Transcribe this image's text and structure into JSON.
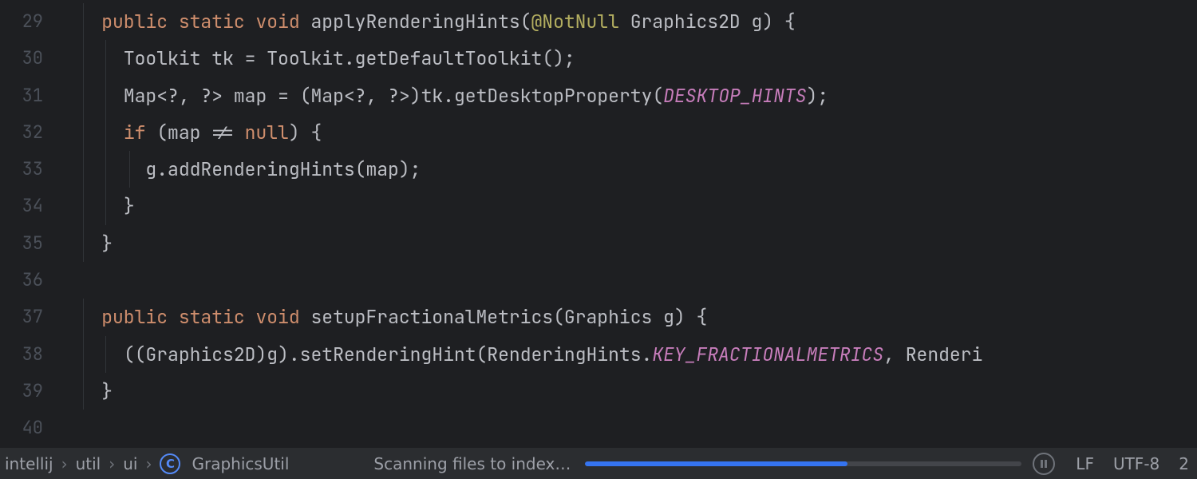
{
  "gutter": {
    "start": 29,
    "end": 40
  },
  "code": {
    "lines": [
      {
        "indents": [
          2
        ],
        "tokens": [
          {
            "cls": "kw",
            "t": "public"
          },
          {
            "cls": "pn",
            "t": " "
          },
          {
            "cls": "kw",
            "t": "static"
          },
          {
            "cls": "pn",
            "t": " "
          },
          {
            "cls": "kw",
            "t": "void"
          },
          {
            "cls": "pn",
            "t": " "
          },
          {
            "cls": "fn",
            "t": "applyRenderingHints"
          },
          {
            "cls": "pn",
            "t": "("
          },
          {
            "cls": "ann",
            "t": "@NotNull"
          },
          {
            "cls": "pn",
            "t": " "
          },
          {
            "cls": "id",
            "t": "Graphics2D g"
          },
          {
            "cls": "pn",
            "t": ") {"
          }
        ]
      },
      {
        "indents": [
          2,
          3
        ],
        "tokens": [
          {
            "cls": "id",
            "t": "Toolkit tk "
          },
          {
            "cls": "op",
            "t": "= "
          },
          {
            "cls": "id",
            "t": "Toolkit"
          },
          {
            "cls": "pn",
            "t": "."
          },
          {
            "cls": "id",
            "t": "getDefaultToolkit"
          },
          {
            "cls": "pn",
            "t": "();"
          }
        ]
      },
      {
        "indents": [
          2,
          3
        ],
        "tokens": [
          {
            "cls": "id",
            "t": "Map"
          },
          {
            "cls": "pn",
            "t": "<"
          },
          {
            "cls": "id",
            "t": "?"
          },
          {
            "cls": "pn",
            "t": ", "
          },
          {
            "cls": "id",
            "t": "?"
          },
          {
            "cls": "pn",
            "t": "> "
          },
          {
            "cls": "id",
            "t": "map "
          },
          {
            "cls": "op",
            "t": "= "
          },
          {
            "cls": "pn",
            "t": "("
          },
          {
            "cls": "id",
            "t": "Map"
          },
          {
            "cls": "pn",
            "t": "<"
          },
          {
            "cls": "id",
            "t": "?"
          },
          {
            "cls": "pn",
            "t": ", "
          },
          {
            "cls": "id",
            "t": "?"
          },
          {
            "cls": "pn",
            "t": ">)"
          },
          {
            "cls": "id",
            "t": "tk"
          },
          {
            "cls": "pn",
            "t": "."
          },
          {
            "cls": "id",
            "t": "getDesktopProperty"
          },
          {
            "cls": "pn",
            "t": "("
          },
          {
            "cls": "cst",
            "t": "DESKTOP_HINTS"
          },
          {
            "cls": "pn",
            "t": ");"
          }
        ]
      },
      {
        "indents": [
          2,
          3
        ],
        "tokens": [
          {
            "cls": "kw",
            "t": "if"
          },
          {
            "cls": "pn",
            "t": " ("
          },
          {
            "cls": "id",
            "t": "map "
          },
          {
            "cls": "op",
            "t": "!= "
          },
          {
            "cls": "kw",
            "t": "null"
          },
          {
            "cls": "pn",
            "t": ") {"
          }
        ]
      },
      {
        "indents": [
          2,
          3,
          4
        ],
        "tokens": [
          {
            "cls": "id",
            "t": "g"
          },
          {
            "cls": "pn",
            "t": "."
          },
          {
            "cls": "id",
            "t": "addRenderingHints"
          },
          {
            "cls": "pn",
            "t": "("
          },
          {
            "cls": "id",
            "t": "map"
          },
          {
            "cls": "pn",
            "t": ");"
          }
        ]
      },
      {
        "indents": [
          2,
          3
        ],
        "tokens": [
          {
            "cls": "pn",
            "t": "}"
          }
        ]
      },
      {
        "indents": [
          2
        ],
        "tokens": [
          {
            "cls": "pn",
            "t": "}"
          }
        ]
      },
      {
        "indents": [],
        "tokens": [
          {
            "cls": "pn",
            "t": ""
          }
        ]
      },
      {
        "indents": [
          2
        ],
        "tokens": [
          {
            "cls": "kw",
            "t": "public"
          },
          {
            "cls": "pn",
            "t": " "
          },
          {
            "cls": "kw",
            "t": "static"
          },
          {
            "cls": "pn",
            "t": " "
          },
          {
            "cls": "kw",
            "t": "void"
          },
          {
            "cls": "pn",
            "t": " "
          },
          {
            "cls": "fn",
            "t": "setupFractionalMetrics"
          },
          {
            "cls": "pn",
            "t": "("
          },
          {
            "cls": "id",
            "t": "Graphics g"
          },
          {
            "cls": "pn",
            "t": ") {"
          }
        ]
      },
      {
        "indents": [
          2,
          3
        ],
        "tokens": [
          {
            "cls": "pn",
            "t": "(("
          },
          {
            "cls": "id",
            "t": "Graphics2D"
          },
          {
            "cls": "pn",
            "t": ")"
          },
          {
            "cls": "id",
            "t": "g"
          },
          {
            "cls": "pn",
            "t": ")."
          },
          {
            "cls": "id",
            "t": "setRenderingHint"
          },
          {
            "cls": "pn",
            "t": "("
          },
          {
            "cls": "id",
            "t": "RenderingHints"
          },
          {
            "cls": "pn",
            "t": "."
          },
          {
            "cls": "cst",
            "t": "KEY_FRACTIONALMETRICS"
          },
          {
            "cls": "pn",
            "t": ", "
          },
          {
            "cls": "id",
            "t": "Renderi"
          }
        ]
      },
      {
        "indents": [
          2
        ],
        "tokens": [
          {
            "cls": "pn",
            "t": "}"
          }
        ]
      },
      {
        "indents": [],
        "tokens": [
          {
            "cls": "pn",
            "t": ""
          }
        ]
      }
    ],
    "base_indent_text": "    ",
    "indent_unit_text": "  "
  },
  "breadcrumbs": {
    "items": [
      "intellij",
      "util",
      "ui",
      "GraphicsUtil"
    ],
    "class_icon_letter": "C"
  },
  "status": {
    "scanning_text": "Scanning files to index…",
    "progress_percent": 60,
    "line_separator": "LF",
    "encoding": "UTF-8",
    "right_number": "2"
  }
}
